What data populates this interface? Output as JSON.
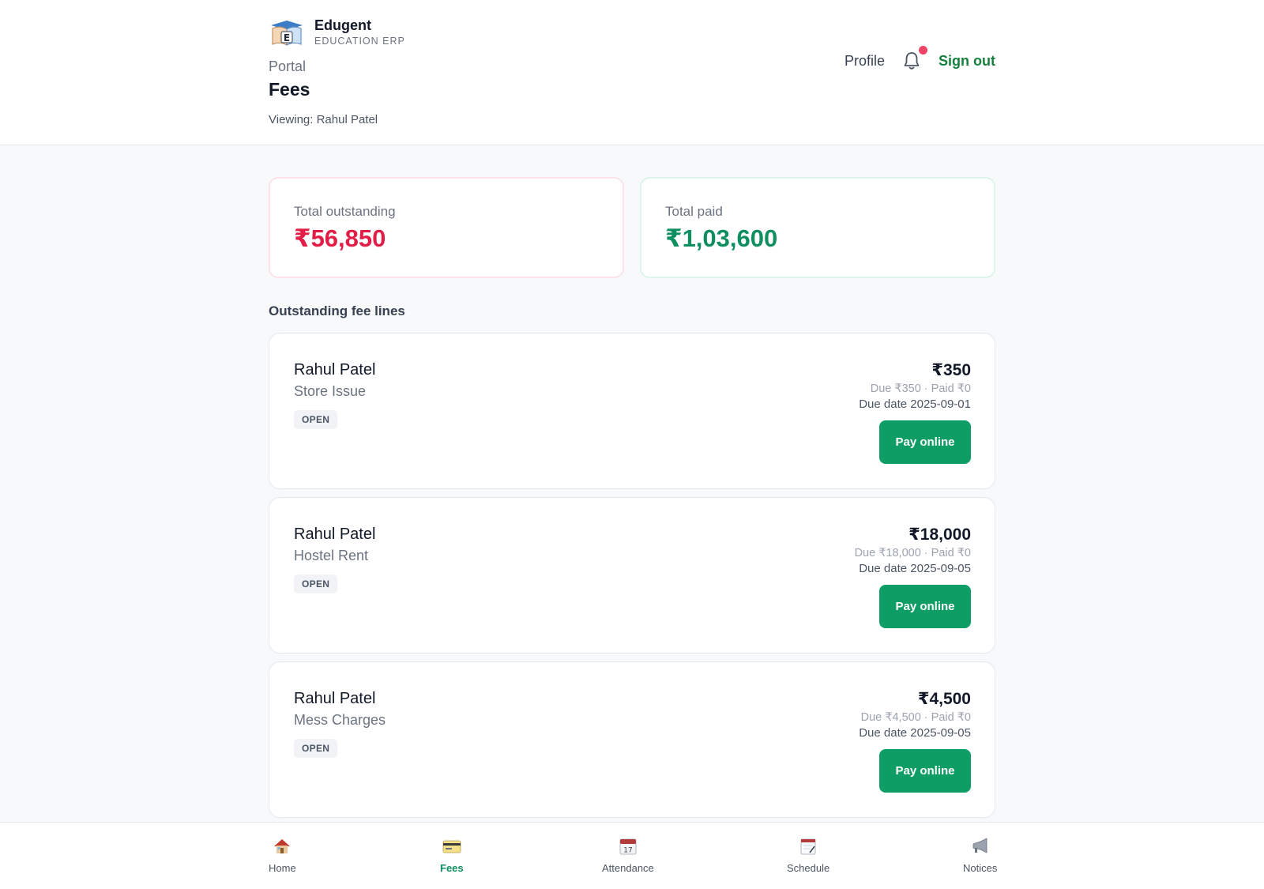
{
  "brand": {
    "name": "Edugent",
    "subtitle": "EDUCATION ERP"
  },
  "header": {
    "portal_label": "Portal",
    "page_title": "Fees",
    "viewing": "Viewing: Rahul Patel",
    "profile": "Profile",
    "sign_out": "Sign out",
    "has_notification": true
  },
  "summary": {
    "outstanding_label": "Total outstanding",
    "outstanding_value": "₹56,850",
    "paid_label": "Total paid",
    "paid_value": "₹1,03,600"
  },
  "section_title": "Outstanding fee lines",
  "fees": [
    {
      "student": "Rahul Patel",
      "type": "Store Issue",
      "status": "OPEN",
      "amount": "₹350",
      "breakdown": "Due ₹350 · Paid ₹0",
      "due_date": "Due date 2025-09-01",
      "action": "Pay online"
    },
    {
      "student": "Rahul Patel",
      "type": "Hostel Rent",
      "status": "OPEN",
      "amount": "₹18,000",
      "breakdown": "Due ₹18,000 · Paid ₹0",
      "due_date": "Due date 2025-09-05",
      "action": "Pay online"
    },
    {
      "student": "Rahul Patel",
      "type": "Mess Charges",
      "status": "OPEN",
      "amount": "₹4,500",
      "breakdown": "Due ₹4,500 · Paid ₹0",
      "due_date": "Due date 2025-09-05",
      "action": "Pay online"
    }
  ],
  "nav": [
    {
      "label": "Home",
      "icon": "house-icon"
    },
    {
      "label": "Fees",
      "icon": "credit-card-icon",
      "active": true
    },
    {
      "label": "Attendance",
      "icon": "calendar-icon"
    },
    {
      "label": "Schedule",
      "icon": "notepad-icon"
    },
    {
      "label": "Notices",
      "icon": "megaphone-icon"
    }
  ],
  "colors": {
    "outstanding": "#e11d48",
    "paid": "#0f8f5f",
    "primary_button": "#0f9d66",
    "notification_dot": "#ef4466"
  }
}
